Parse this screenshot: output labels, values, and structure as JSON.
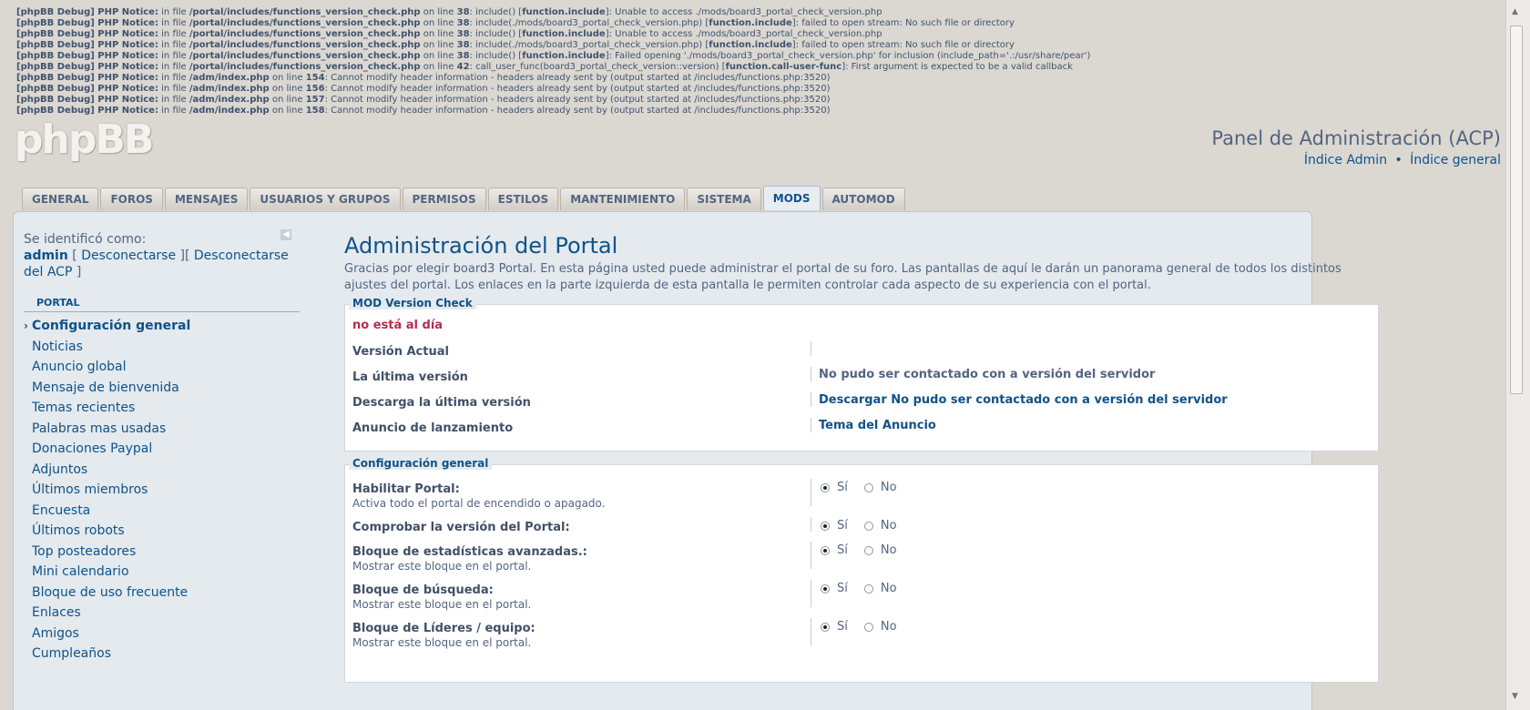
{
  "debug_lines": [
    {
      "prefix": "[phpBB Debug] PHP Notice:",
      "text1": " in file ",
      "file": "/portal/includes/functions_version_check.php",
      "text2": " on line ",
      "line": "38",
      "text3": ": include() [",
      "fn": "function.include",
      "text4": "]: Unable to access ./mods/board3_portal_check_version.php"
    },
    {
      "prefix": "[phpBB Debug] PHP Notice:",
      "text1": " in file ",
      "file": "/portal/includes/functions_version_check.php",
      "text2": " on line ",
      "line": "38",
      "text3": ": include(./mods/board3_portal_check_version.php) [",
      "fn": "function.include",
      "text4": "]: failed to open stream: No such file or directory"
    },
    {
      "prefix": "[phpBB Debug] PHP Notice:",
      "text1": " in file ",
      "file": "/portal/includes/functions_version_check.php",
      "text2": " on line ",
      "line": "38",
      "text3": ": include() [",
      "fn": "function.include",
      "text4": "]: Unable to access ./mods/board3_portal_check_version.php"
    },
    {
      "prefix": "[phpBB Debug] PHP Notice:",
      "text1": " in file ",
      "file": "/portal/includes/functions_version_check.php",
      "text2": " on line ",
      "line": "38",
      "text3": ": include(./mods/board3_portal_check_version.php) [",
      "fn": "function.include",
      "text4": "]: failed to open stream: No such file or directory"
    },
    {
      "prefix": "[phpBB Debug] PHP Notice:",
      "text1": " in file ",
      "file": "/portal/includes/functions_version_check.php",
      "text2": " on line ",
      "line": "38",
      "text3": ": include() [",
      "fn": "function.include",
      "text4": "]: Failed opening './mods/board3_portal_check_version.php' for inclusion (include_path='.:/usr/share/pear')"
    },
    {
      "prefix": "[phpBB Debug] PHP Notice:",
      "text1": " in file ",
      "file": "/portal/includes/functions_version_check.php",
      "text2": " on line ",
      "line": "42",
      "text3": ": call_user_func(board3_portal_check_version::version) [",
      "fn": "function.call-user-func",
      "text4": "]: First argument is expected to be a valid callback"
    },
    {
      "prefix": "[phpBB Debug] PHP Notice:",
      "text1": " in file ",
      "file": "/adm/index.php",
      "text2": " on line ",
      "line": "154",
      "text3": ": Cannot modify header information - headers already sent by (output started at /includes/functions.php:3520)",
      "fn": "",
      "text4": ""
    },
    {
      "prefix": "[phpBB Debug] PHP Notice:",
      "text1": " in file ",
      "file": "/adm/index.php",
      "text2": " on line ",
      "line": "156",
      "text3": ": Cannot modify header information - headers already sent by (output started at /includes/functions.php:3520)",
      "fn": "",
      "text4": ""
    },
    {
      "prefix": "[phpBB Debug] PHP Notice:",
      "text1": " in file ",
      "file": "/adm/index.php",
      "text2": " on line ",
      "line": "157",
      "text3": ": Cannot modify header information - headers already sent by (output started at /includes/functions.php:3520)",
      "fn": "",
      "text4": ""
    },
    {
      "prefix": "[phpBB Debug] PHP Notice:",
      "text1": " in file ",
      "file": "/adm/index.php",
      "text2": " on line ",
      "line": "158",
      "text3": ": Cannot modify header information - headers already sent by (output started at /includes/functions.php:3520)",
      "fn": "",
      "text4": ""
    }
  ],
  "header": {
    "logo": "phpBB",
    "title": "Panel de Administración (ACP)",
    "link_admin": "Índice Admin",
    "separator": "•",
    "link_general": "Índice general"
  },
  "tabs": [
    "GENERAL",
    "FOROS",
    "MENSAJES",
    "USUARIOS Y GRUPOS",
    "PERMISOS",
    "ESTILOS",
    "MANTENIMIENTO",
    "SISTEMA",
    "MODS",
    "AUTOMOD"
  ],
  "active_tab": "MODS",
  "sidebar": {
    "identified_label": "Se identificó como:",
    "username": "admin",
    "logout_open": " [ ",
    "logout_label": "Desconectarse",
    "logout_mid": " ][ ",
    "logout_acp_label": "Desconectarse del ACP",
    "logout_close": " ]",
    "section_title": "PORTAL",
    "items": [
      {
        "label": "Configuración general",
        "active": true
      },
      {
        "label": "Noticias",
        "active": false
      },
      {
        "label": "Anuncio global",
        "active": false
      },
      {
        "label": "Mensaje de bienvenida",
        "active": false
      },
      {
        "label": "Temas recientes",
        "active": false
      },
      {
        "label": "Palabras mas usadas",
        "active": false
      },
      {
        "label": "Donaciones Paypal",
        "active": false
      },
      {
        "label": "Adjuntos",
        "active": false
      },
      {
        "label": "Últimos miembros",
        "active": false
      },
      {
        "label": "Encuesta",
        "active": false
      },
      {
        "label": "Últimos robots",
        "active": false
      },
      {
        "label": "Top posteadores",
        "active": false
      },
      {
        "label": "Mini calendario",
        "active": false
      },
      {
        "label": "Bloque de uso frecuente",
        "active": false
      },
      {
        "label": "Enlaces",
        "active": false
      },
      {
        "label": "Amigos",
        "active": false
      },
      {
        "label": "Cumpleaños",
        "active": false
      }
    ]
  },
  "main": {
    "title": "Administración del Portal",
    "intro": "Gracias por elegir board3 Portal. En esta página usted puede administrar el portal de su foro. Las pantallas de aquí le darán un panorama general de todos los distintos ajustes del portal. Los enlaces en la parte izquierda de esta pantalla le permiten controlar cada aspecto de su experiencia con el portal.",
    "version_check": {
      "legend": "MOD Version Check",
      "status": "no está al día",
      "rows": [
        {
          "label": "Versión Actual",
          "value": "",
          "is_link": false
        },
        {
          "label": "La última versión",
          "value": "No pudo ser contactado con a versión del servidor",
          "is_link": false
        },
        {
          "label": "Descarga la última versión",
          "value": "Descargar No pudo ser contactado con a versión del servidor",
          "is_link": true
        },
        {
          "label": "Anuncio de lanzamiento",
          "value": "Tema del Anuncio",
          "is_link": true
        }
      ]
    },
    "general_config": {
      "legend": "Configuración general",
      "yes_label": "Sí",
      "no_label": "No",
      "rows": [
        {
          "label": "Habilitar Portal:",
          "desc": "Activa todo el portal de encendido o apagado.",
          "value": "yes"
        },
        {
          "label": "Comprobar la versión del Portal:",
          "desc": "",
          "value": "yes"
        },
        {
          "label": "Bloque de estadísticas avanzadas.:",
          "desc": "Mostrar este bloque en el portal.",
          "value": "yes"
        },
        {
          "label": "Bloque de búsqueda:",
          "desc": "Mostrar este bloque en el portal.",
          "value": "yes"
        },
        {
          "label": "Bloque de Líderes / equipo:",
          "desc": "Mostrar este bloque en el portal.",
          "value": "yes"
        }
      ]
    }
  }
}
